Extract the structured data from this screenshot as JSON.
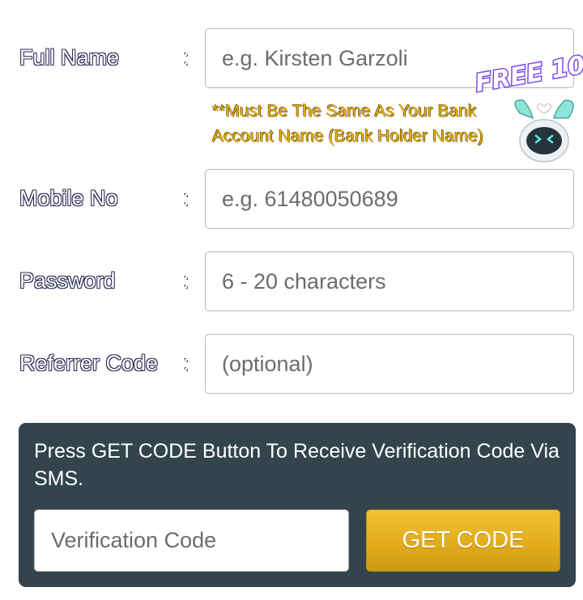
{
  "form": {
    "full_name": {
      "label": "Full Name",
      "colon": ":",
      "placeholder": "e.g. Kirsten Garzoli",
      "hint": "**Must Be The Same As Your Bank Account Name (Bank Holder Name)"
    },
    "mobile": {
      "label": "Mobile No",
      "colon": ":",
      "placeholder": "e.g. 61480050689"
    },
    "password": {
      "label": "Password",
      "colon": ":",
      "placeholder": "6 - 20 characters"
    },
    "referrer": {
      "label": "Referrer Code",
      "colon": ":",
      "placeholder": "(optional)"
    }
  },
  "promo": {
    "text": "FREE 10",
    "icon": "robot-mascot-icon"
  },
  "verification": {
    "instruction": "Press GET CODE Button To Receive Verification Code Via SMS.",
    "placeholder": "Verification Code",
    "button_label": "GET CODE"
  },
  "colors": {
    "panel_bg": "#34444d",
    "accent_gold": "#e2ac1c",
    "hint_yellow": "#f0b400",
    "promo_purple": "#7a4df0"
  }
}
